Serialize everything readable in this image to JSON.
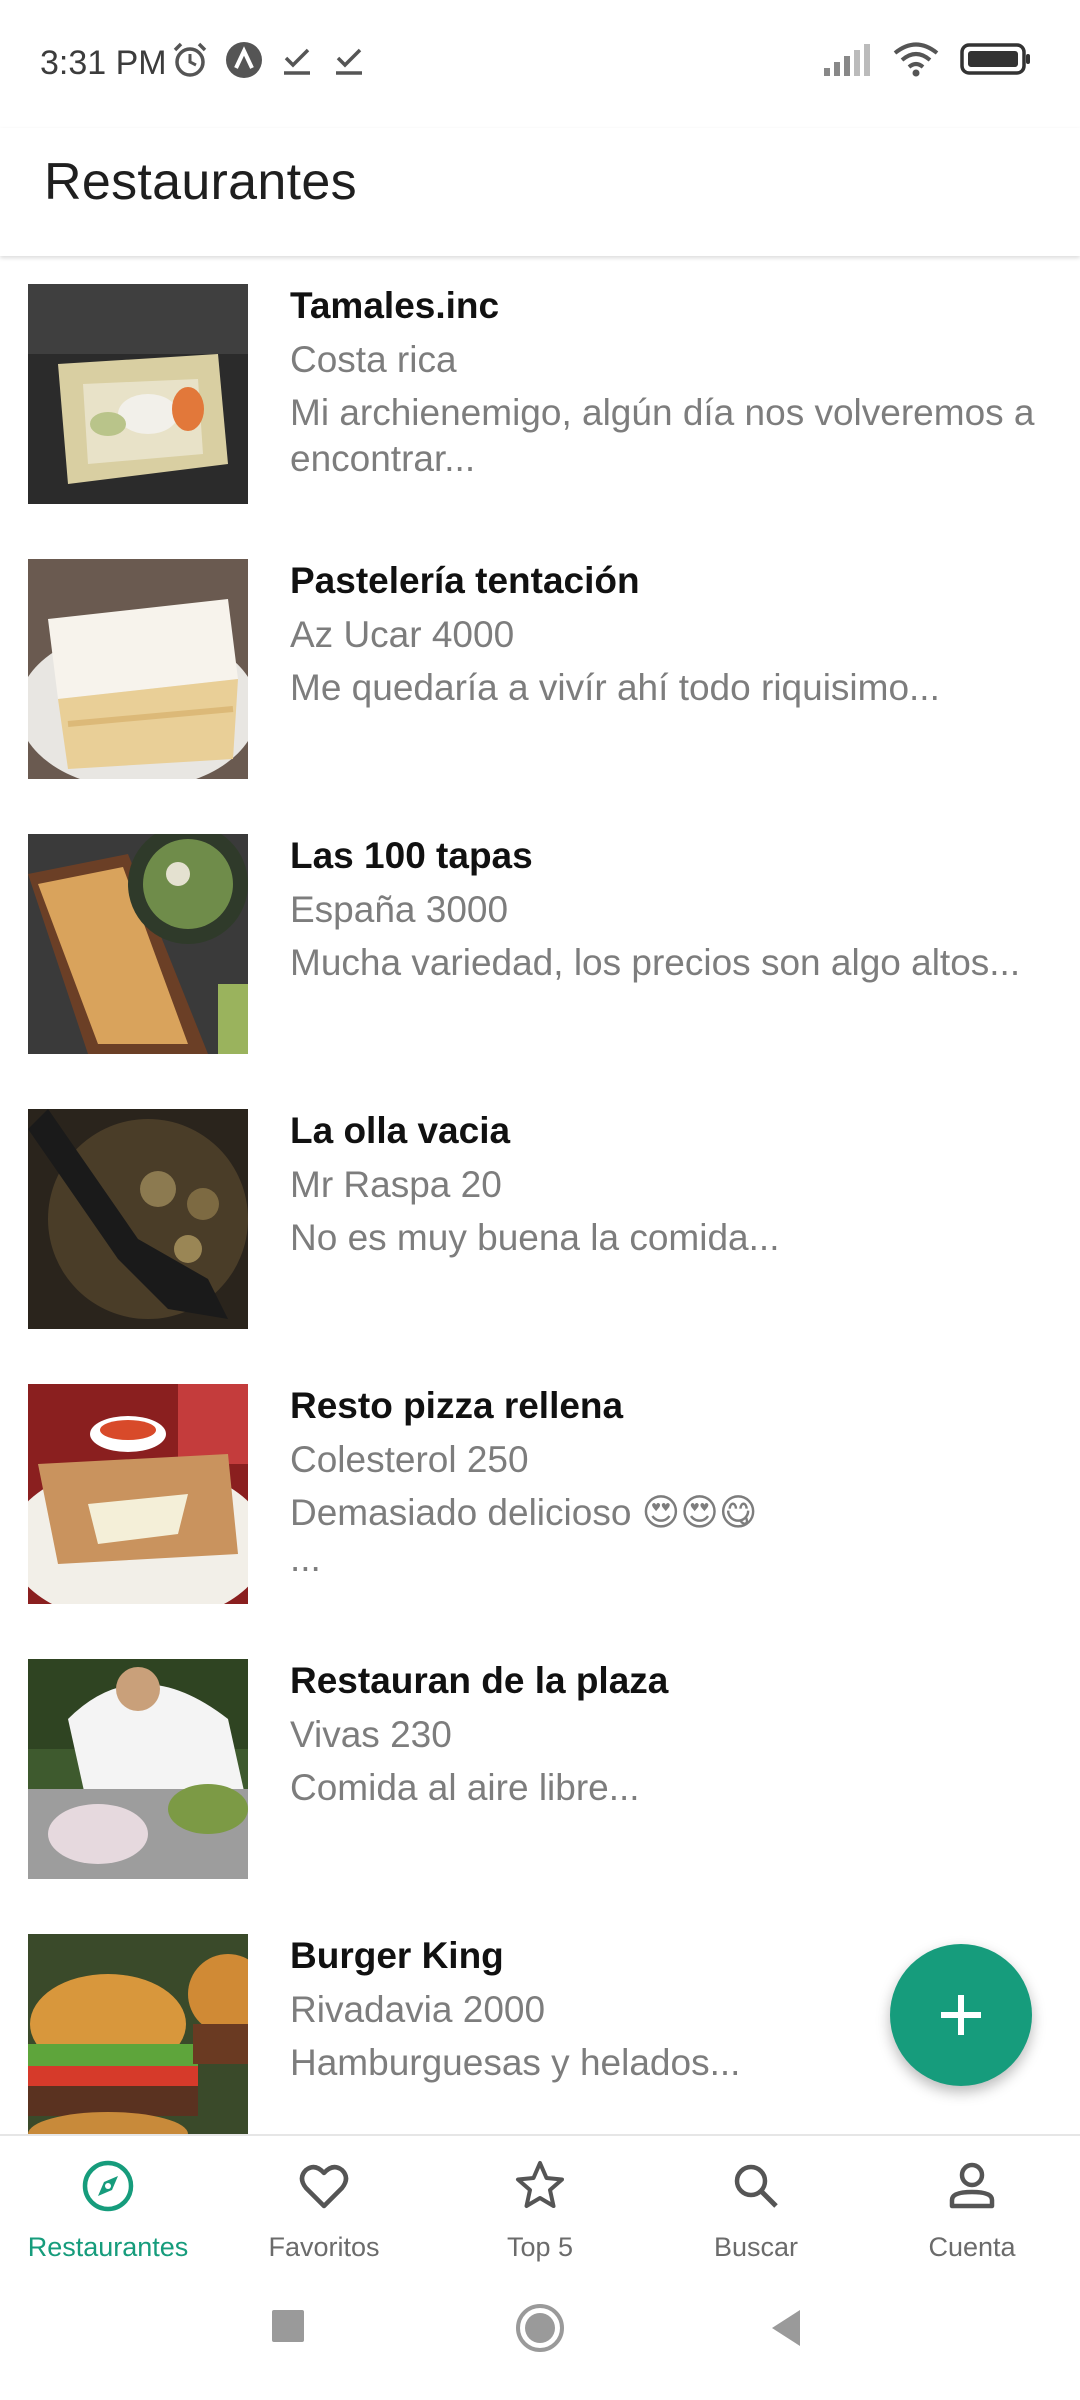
{
  "status_bar": {
    "time": "3:31 PM",
    "icons_left": [
      "alarm-icon",
      "notification-a-icon",
      "check-icon",
      "check-icon"
    ],
    "icons_right": [
      "signal-icon",
      "wifi-icon",
      "battery-icon"
    ]
  },
  "app_bar": {
    "title": "Restaurantes"
  },
  "restaurants": [
    {
      "name": "Tamales.inc",
      "address": "Costa rica",
      "description": "Mi archienemigo, algún día nos volveremos a encontrar..."
    },
    {
      "name": "Pastelería tentación",
      "address": "Az Ucar 4000",
      "description": "Me quedaría a vivír ahí todo riquisimo..."
    },
    {
      "name": "Las 100 tapas",
      "address": "España 3000",
      "description": "Mucha variedad, los precios son algo altos..."
    },
    {
      "name": "La olla vacia",
      "address": "Mr Raspa 20",
      "description": "No es muy buena la comida..."
    },
    {
      "name": "Resto pizza rellena",
      "address": "Colesterol 250",
      "description": "Demasiado delicioso 😍😍😋\n..."
    },
    {
      "name": "Restauran de la plaza",
      "address": "Vivas 230",
      "description": "Comida al aire libre..."
    },
    {
      "name": "Burger King",
      "address": "Rivadavia 2000",
      "description": "Hamburguesas y helados..."
    }
  ],
  "fab": {
    "icon": "plus-icon"
  },
  "bottom_nav": {
    "items": [
      {
        "label": "Restaurantes",
        "icon": "compass-icon",
        "active": true
      },
      {
        "label": "Favoritos",
        "icon": "heart-icon",
        "active": false
      },
      {
        "label": "Top 5",
        "icon": "star-icon",
        "active": false
      },
      {
        "label": "Buscar",
        "icon": "search-icon",
        "active": false
      },
      {
        "label": "Cuenta",
        "icon": "account-icon",
        "active": false
      }
    ]
  },
  "colors": {
    "accent": "#169c7c",
    "secondary_text": "#7d7d7d",
    "inactive_nav": "#6b6b6b"
  }
}
